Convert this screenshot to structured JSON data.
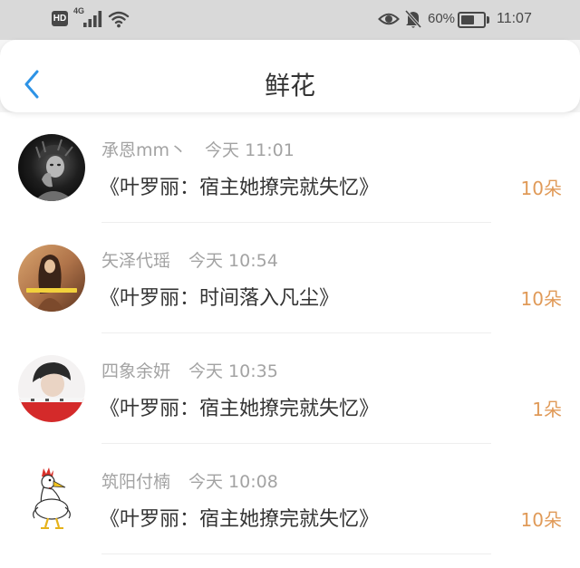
{
  "status_bar": {
    "network_badge": "HD",
    "network_type": "4G",
    "battery_text": "60%",
    "battery_level": 0.6,
    "time": "11:07",
    "icons": [
      "signal-icon",
      "wifi-icon",
      "eye-icon",
      "bell-off-icon",
      "battery-icon"
    ]
  },
  "header": {
    "title": "鲜花",
    "back_icon": "chevron-left-icon"
  },
  "list": {
    "items": [
      {
        "name": "承恩mm丶",
        "time": "今天 11:01",
        "book": "《叶罗丽：宿主她撩完就失忆》",
        "count": "10朵"
      },
      {
        "name": "矢泽代瑶",
        "time": "今天 10:54",
        "book": "《叶罗丽：时间落入凡尘》",
        "count": "10朵"
      },
      {
        "name": "四象余妍",
        "time": "今天 10:35",
        "book": "《叶罗丽：宿主她撩完就失忆》",
        "count": "1朵"
      },
      {
        "name": "筑阳付楠",
        "time": "今天 10:08",
        "book": "《叶罗丽：宿主她撩完就失忆》",
        "count": "10朵"
      }
    ]
  },
  "colors": {
    "status_bar_bg": "#d9d9d9",
    "accent": "#2d93e6",
    "meta": "#a3a3a3",
    "text": "#333333",
    "count": "#e09a58",
    "divider": "#eeeeee"
  }
}
